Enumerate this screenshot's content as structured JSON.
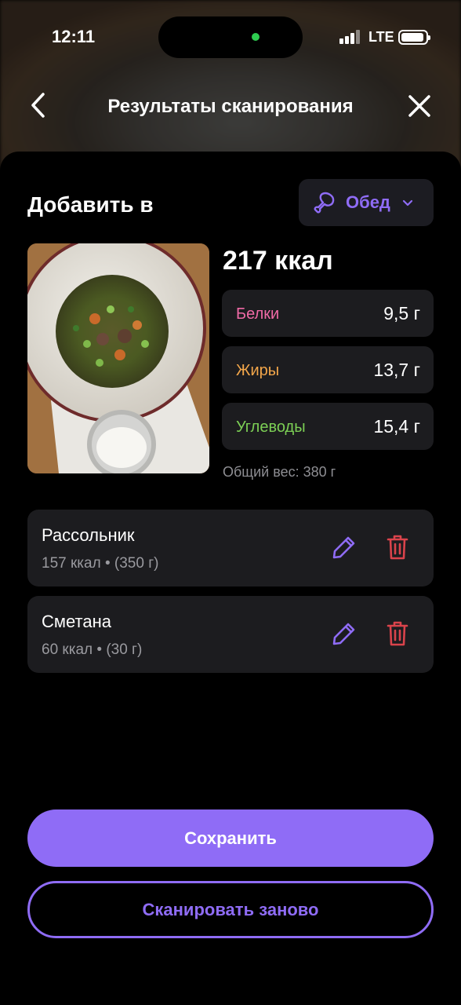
{
  "status_bar": {
    "time": "12:11",
    "network": "LTE"
  },
  "nav": {
    "title": "Результаты сканирования",
    "back_icon": "chevron-left-icon",
    "close_icon": "close-icon"
  },
  "add_to": {
    "label": "Добавить в",
    "meal": "Обед",
    "meal_icon": "chicken-leg-icon"
  },
  "nutrition": {
    "total_kcal": "217 ккал",
    "macros": [
      {
        "label": "Белки",
        "value": "9,5 г",
        "color": "#f06aa6"
      },
      {
        "label": "Жиры",
        "value": "13,7 г",
        "color": "#f2a64a"
      },
      {
        "label": "Углеводы",
        "value": "15,4 г",
        "color": "#7ccf55"
      }
    ],
    "total_weight": "Общий вес: 380 г"
  },
  "items": [
    {
      "name": "Рассольник",
      "meta": "157 ккал • (350 г)"
    },
    {
      "name": "Сметана",
      "meta": "60 ккал • (30 г)"
    }
  ],
  "actions": {
    "save": "Сохранить",
    "rescan": "Сканировать заново"
  },
  "colors": {
    "accent": "#8f6cf6",
    "delete": "#d9434b",
    "card": "#1c1c1f"
  }
}
